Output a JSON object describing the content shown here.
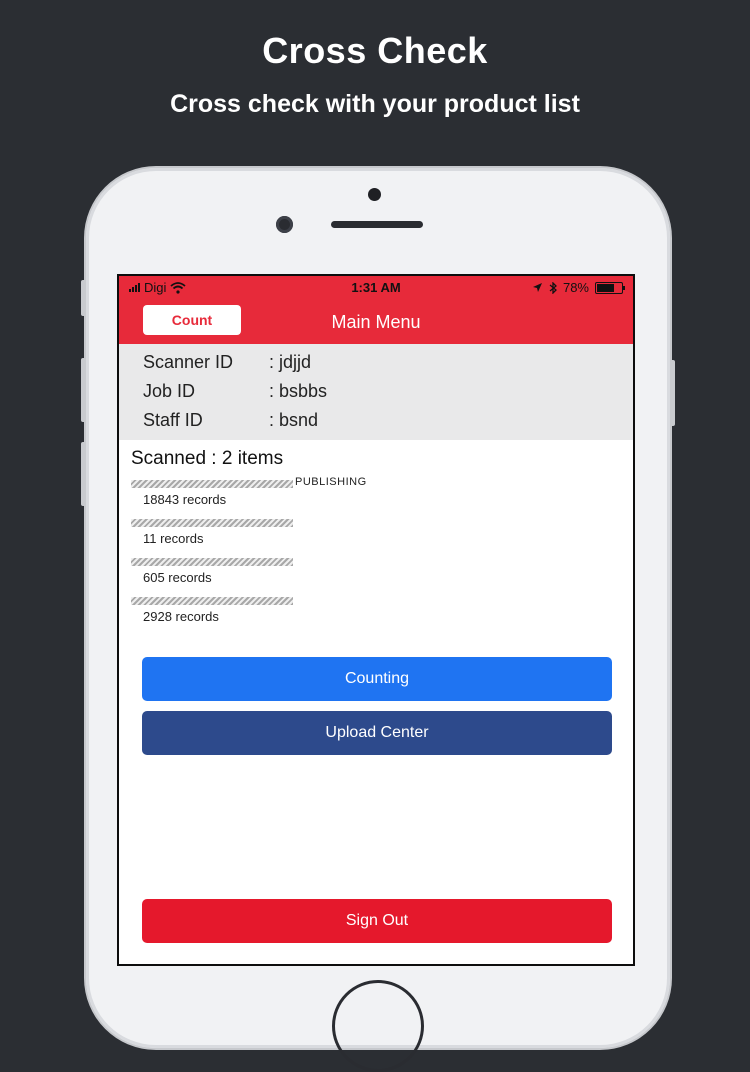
{
  "promo": {
    "title": "Cross Check",
    "subtitle": "Cross check with your product list"
  },
  "status_bar": {
    "carrier": "Digi",
    "time": "1:31 AM",
    "battery": "78%",
    "battery_level": 0.78
  },
  "nav": {
    "count_button": "Count",
    "title": "Main Menu"
  },
  "info": {
    "scanner_label": "Scanner ID",
    "scanner_value": ": jdjjd",
    "job_label": "Job ID",
    "job_value": ": bsbbs",
    "staff_label": "Staff ID",
    "staff_value": ": bsnd"
  },
  "scanned": "Scanned  : 2 items",
  "records": [
    {
      "tag": "PUBLISHING",
      "text": "18843 records"
    },
    {
      "tag": "",
      "text": "11 records"
    },
    {
      "tag": "",
      "text": "605 records"
    },
    {
      "tag": "",
      "text": "2928 records"
    }
  ],
  "buttons": {
    "counting": "Counting",
    "upload_center": "Upload Center",
    "sign_out": "Sign Out"
  },
  "colors": {
    "brand_red": "#e72a3a",
    "counting_blue": "#1f74f2",
    "upload_navy": "#2d4a8c",
    "signout_red": "#e5182c"
  }
}
